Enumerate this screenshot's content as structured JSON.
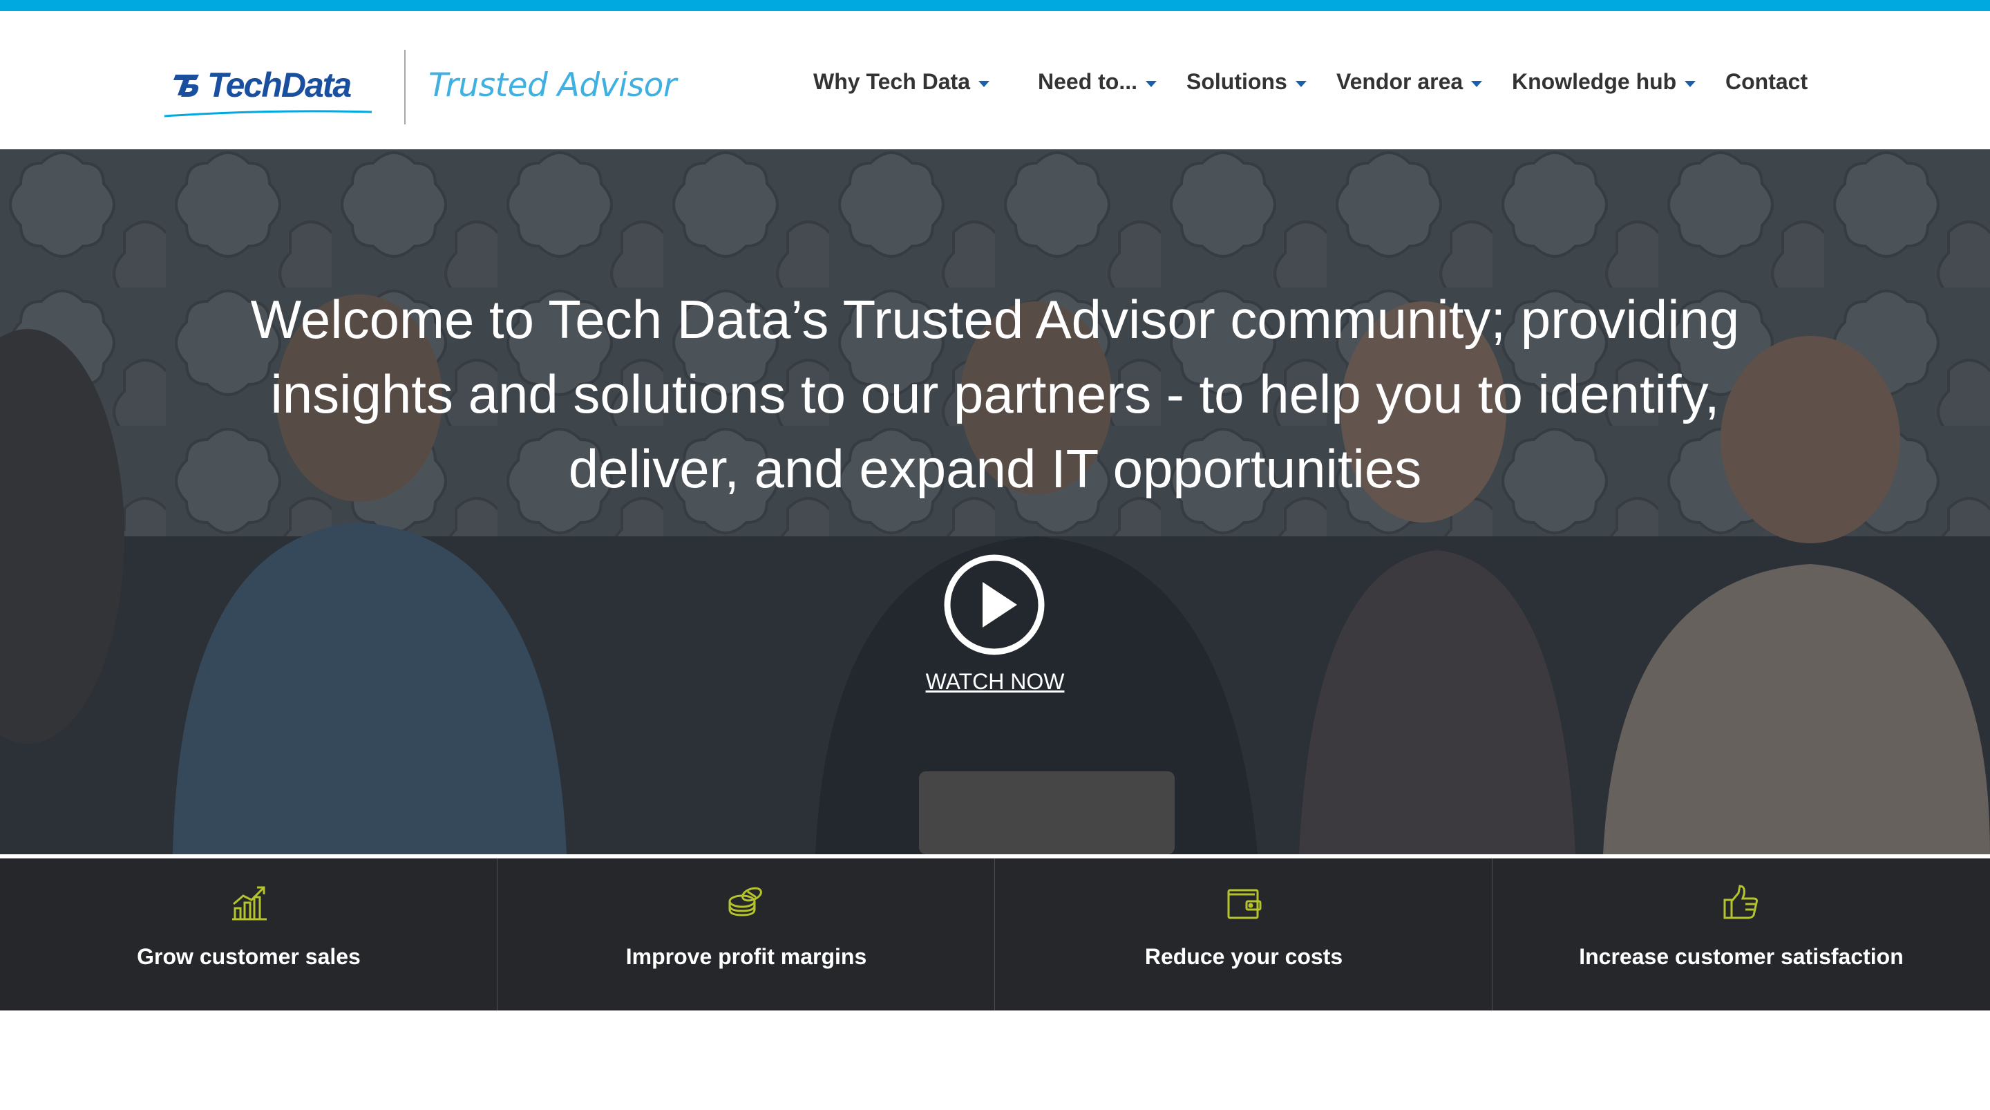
{
  "brand": {
    "name": "TechData",
    "subtitle": "Trusted Advisor",
    "primary_color": "#1a4fa0",
    "accent_color": "#00a9e0"
  },
  "nav": {
    "items": [
      {
        "label": "Why Tech Data",
        "has_dropdown": true
      },
      {
        "label": "Need to...",
        "has_dropdown": true
      },
      {
        "label": "Solutions",
        "has_dropdown": true
      },
      {
        "label": "Vendor area",
        "has_dropdown": true
      },
      {
        "label": "Knowledge hub",
        "has_dropdown": true
      },
      {
        "label": "Contact",
        "has_dropdown": false
      }
    ]
  },
  "hero": {
    "headline_lines": [
      "Welcome to Tech Data’s Trusted Advisor community; providing",
      "insights and solutions to our partners - to help you to identify,",
      "deliver, and expand IT opportunities"
    ],
    "play_icon": "play-circle-icon",
    "cta_label": "WATCH NOW"
  },
  "benefits": {
    "icon_color": "#b5c42c",
    "items": [
      {
        "label": "Grow customer sales",
        "icon": "growth-chart-icon"
      },
      {
        "label": "Improve profit margins",
        "icon": "coins-icon"
      },
      {
        "label": "Reduce your costs",
        "icon": "wallet-icon"
      },
      {
        "label": "Increase customer satisfaction",
        "icon": "thumbs-up-icon"
      }
    ]
  }
}
